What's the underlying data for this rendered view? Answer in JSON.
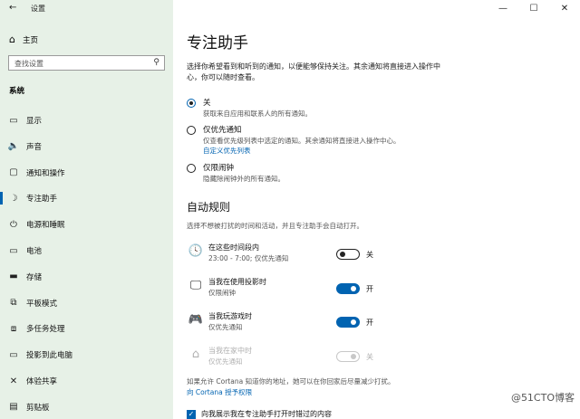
{
  "window": {
    "title": "设置",
    "back_glyph": "←",
    "min_glyph": "—",
    "max_glyph": "☐",
    "close_glyph": "✕"
  },
  "sidebar": {
    "home_label": "主页",
    "search_placeholder": "查找设置",
    "section_label": "系统",
    "items": [
      {
        "label": "显示",
        "icon": "display-icon",
        "glyph": "▭"
      },
      {
        "label": "声音",
        "icon": "speaker-icon",
        "glyph": "🔈"
      },
      {
        "label": "通知和操作",
        "icon": "notification-icon",
        "glyph": "▢"
      },
      {
        "label": "专注助手",
        "icon": "moon-icon",
        "glyph": "☽"
      },
      {
        "label": "电源和睡眠",
        "icon": "power-icon",
        "glyph": "⏻"
      },
      {
        "label": "电池",
        "icon": "battery-icon",
        "glyph": "▭"
      },
      {
        "label": "存储",
        "icon": "storage-icon",
        "glyph": "▬"
      },
      {
        "label": "平板模式",
        "icon": "tablet-icon",
        "glyph": "⧉"
      },
      {
        "label": "多任务处理",
        "icon": "multitask-icon",
        "glyph": "⧈"
      },
      {
        "label": "投影到此电脑",
        "icon": "projector-icon",
        "glyph": "▭"
      },
      {
        "label": "体验共享",
        "icon": "share-icon",
        "glyph": "✕"
      },
      {
        "label": "剪贴板",
        "icon": "clipboard-icon",
        "glyph": "▤"
      }
    ],
    "active_index": 3
  },
  "main": {
    "title": "专注助手",
    "description": "选择你希望看到和听到的通知，以便能够保持关注。其余通知将直接进入操作中心，你可以随时查看。",
    "options": [
      {
        "label": "关",
        "sub": "获取来自应用和联系人的所有通知。",
        "selected": true
      },
      {
        "label": "仅优先通知",
        "sub": "仅查看优先级列表中选定的通知。其余通知将直接进入操作中心。",
        "link": "自定义优先列表",
        "selected": false
      },
      {
        "label": "仅限闹钟",
        "sub": "隐藏除闹钟外的所有通知。",
        "selected": false
      }
    ],
    "auto_rules_title": "自动规则",
    "auto_rules_desc": "选择不想被打扰的时间和活动，并且专注助手会自动打开。",
    "rules": [
      {
        "icon": "clock-icon",
        "glyph": "🕓",
        "label": "在这些时间段内",
        "sub": "23:00 - 7:00; 仅优先通知",
        "on": false,
        "state": "关",
        "enabled": true
      },
      {
        "icon": "monitor-icon",
        "glyph": "🖵",
        "label": "当我在使用投影时",
        "sub": "仅限闹钟",
        "on": true,
        "state": "开",
        "enabled": true
      },
      {
        "icon": "gamepad-icon",
        "glyph": "🎮",
        "label": "当我玩游戏时",
        "sub": "仅优先通知",
        "on": true,
        "state": "开",
        "enabled": true
      },
      {
        "icon": "home-icon",
        "glyph": "⌂",
        "label": "当我在家中时",
        "sub": "仅优先通知",
        "on": true,
        "state": "关",
        "enabled": false
      }
    ],
    "cortana_text": "如果允许 Cortana 知道你的地址，她可以在你回家后尽量减少打扰。",
    "cortana_link": "向 Cortana 授予权限",
    "summary_checkbox": "向我展示我在专注助手打开时错过的内容",
    "summary_checked": true
  },
  "watermark": "@51CTO博客"
}
